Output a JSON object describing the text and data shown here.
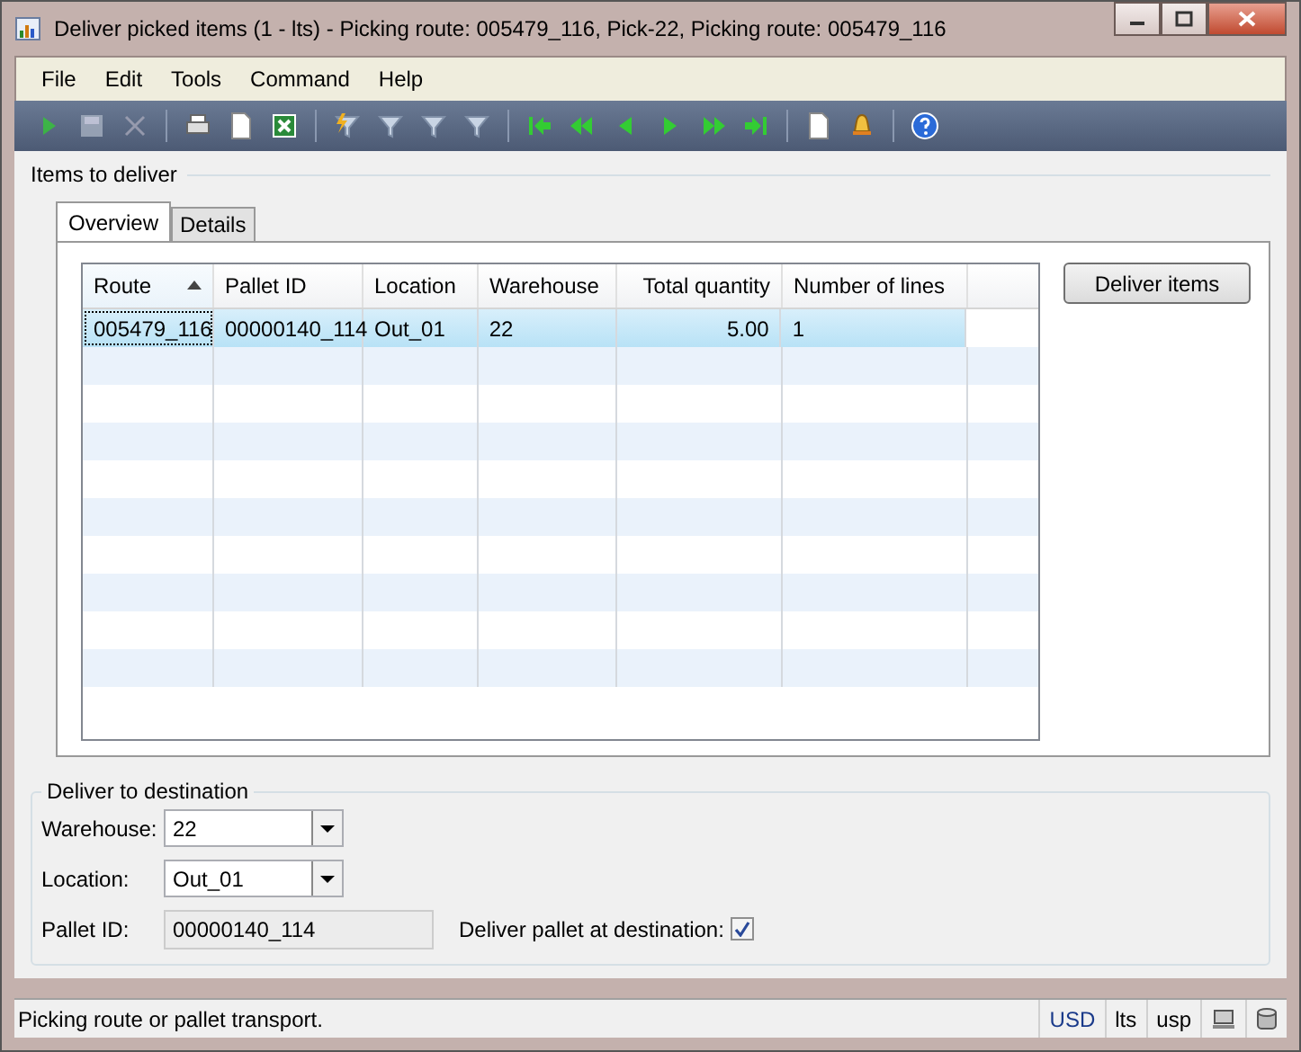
{
  "window": {
    "title": "Deliver picked items (1 - lts) - Picking route: 005479_116, Pick-22, Picking route: 005479_116"
  },
  "menu": [
    "File",
    "Edit",
    "Tools",
    "Command",
    "Help"
  ],
  "items_group": {
    "title": "Items to deliver"
  },
  "tabs": [
    {
      "label": "Overview",
      "selected": true
    },
    {
      "label": "Details",
      "selected": false
    }
  ],
  "table": {
    "columns": [
      {
        "label": "Route",
        "sorted": true,
        "kind": "text"
      },
      {
        "label": "Pallet ID",
        "sorted": false,
        "kind": "text"
      },
      {
        "label": "Location",
        "sorted": false,
        "kind": "text"
      },
      {
        "label": "Warehouse",
        "sorted": false,
        "kind": "text"
      },
      {
        "label": "Total quantity",
        "sorted": false,
        "kind": "number"
      },
      {
        "label": "Number of lines",
        "sorted": false,
        "kind": "text"
      }
    ],
    "rows": [
      {
        "cells": [
          "005479_116",
          "00000140_114",
          "Out_01",
          "22",
          "5.00",
          "1"
        ],
        "selected": true
      }
    ]
  },
  "deliver_button": "Deliver items",
  "destination": {
    "title": "Deliver to destination",
    "warehouse_label": "Warehouse:",
    "warehouse": "22",
    "location_label": "Location:",
    "location": "Out_01",
    "pallet_label": "Pallet ID:",
    "pallet": "00000140_114",
    "deliver_label": "Deliver pallet at destination:",
    "deliver_checked": true
  },
  "status_bar": {
    "text": "Picking route or pallet transport.",
    "currency": "USD",
    "company": "lts",
    "layer": "usp"
  }
}
